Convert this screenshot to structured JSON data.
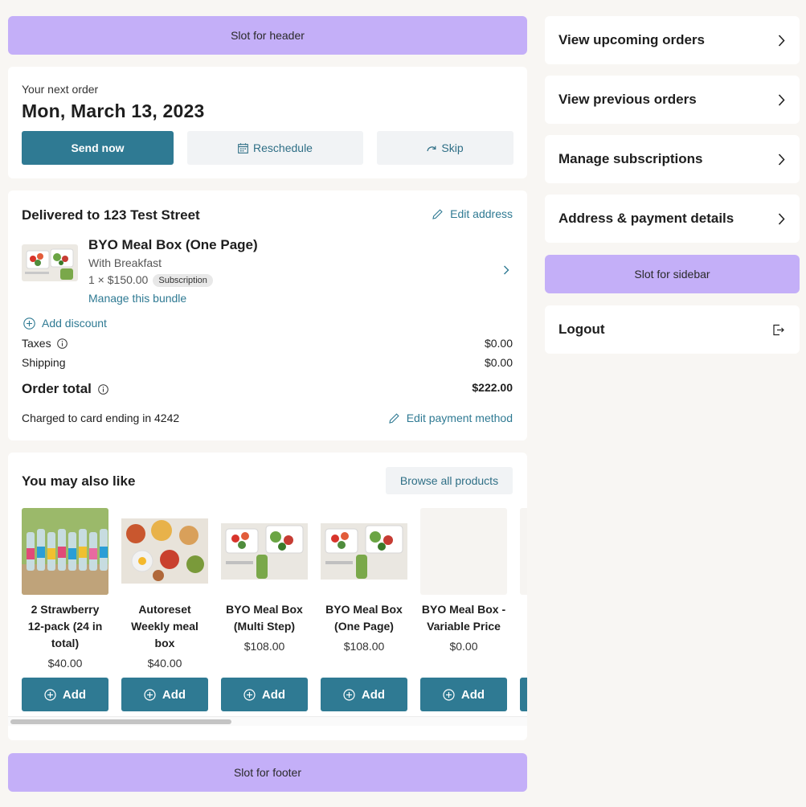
{
  "slots": {
    "header": "Slot for header",
    "sidebar": "Slot for sidebar",
    "footer": "Slot for footer"
  },
  "next_order": {
    "label": "Your next order",
    "date": "Mon, March 13, 2023",
    "send_now": "Send now",
    "reschedule": "Reschedule",
    "skip": "Skip"
  },
  "delivery": {
    "title": "Delivered to 123 Test Street",
    "edit_address": "Edit address",
    "item": {
      "name": "BYO Meal Box (One Page)",
      "variant": "With Breakfast",
      "qty_price": "1 × $150.00",
      "badge": "Subscription",
      "manage": "Manage this bundle"
    },
    "add_discount": "Add discount",
    "taxes_label": "Taxes",
    "taxes_value": "$0.00",
    "shipping_label": "Shipping",
    "shipping_value": "$0.00",
    "total_label": "Order total",
    "total_value": "$222.00",
    "charged": "Charged to card ending in 4242",
    "edit_payment": "Edit payment method"
  },
  "recommendations": {
    "title": "You may also like",
    "browse": "Browse all products",
    "add_label": "Add",
    "products": [
      {
        "name": "2 Strawberry 12-pack (24 in total)",
        "price": "$40.00"
      },
      {
        "name": "Autoreset Weekly meal box",
        "price": "$40.00"
      },
      {
        "name": "BYO Meal Box (Multi Step)",
        "price": "$108.00"
      },
      {
        "name": "BYO Meal Box (One Page)",
        "price": "$108.00"
      },
      {
        "name": "BYO Meal Box - Variable Price",
        "price": "$0.00"
      }
    ]
  },
  "sidebar": {
    "items": [
      {
        "label": "View upcoming orders",
        "icon": "chevron-right-icon"
      },
      {
        "label": "View previous orders",
        "icon": "chevron-right-icon"
      },
      {
        "label": "Manage subscriptions",
        "icon": "chevron-right-icon"
      },
      {
        "label": "Address & payment details",
        "icon": "chevron-right-icon"
      }
    ],
    "logout": "Logout"
  },
  "colors": {
    "accent": "#2f7a93",
    "slot": "#c4aff8",
    "background": "#f8f6f3"
  }
}
